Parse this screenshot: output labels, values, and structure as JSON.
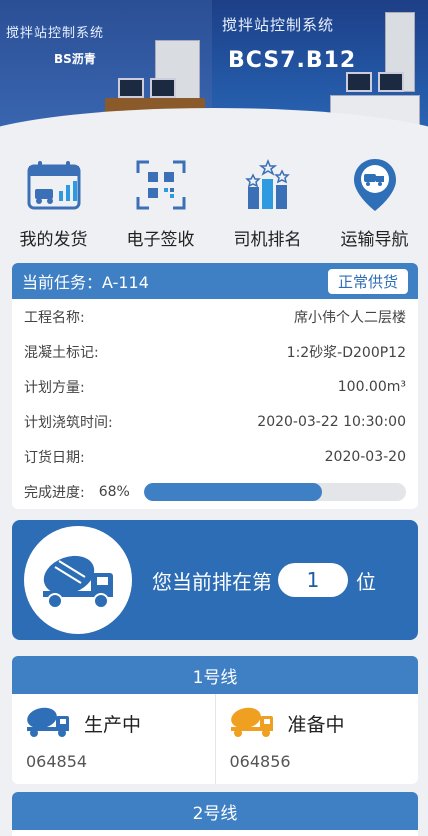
{
  "banner": {
    "left_title": "搅拌站控制系统",
    "left_subtitle": "BS沥青",
    "right_title": "搅拌站控制系统",
    "right_subtitle": "BCS7.B12"
  },
  "nav": [
    {
      "label": "我的发货",
      "icon": "delivery-calendar-icon"
    },
    {
      "label": "电子签收",
      "icon": "qr-code-icon"
    },
    {
      "label": "司机排名",
      "icon": "ranking-bars-icon"
    },
    {
      "label": "运输导航",
      "icon": "location-pin-icon"
    }
  ],
  "task": {
    "title": "当前任务：A-114",
    "status": "正常供货",
    "rows": [
      {
        "label": "工程名称:",
        "value": "席小伟个人二层楼"
      },
      {
        "label": "混凝土标记:",
        "value": "1:2砂浆-D200P12"
      },
      {
        "label": "计划方量:",
        "value": "100.00m³"
      },
      {
        "label": "计划浇筑时间:",
        "value": "2020-03-22 10:30:00"
      },
      {
        "label": "订货日期:",
        "value": "2020-03-20"
      }
    ],
    "progress_label": "完成进度:",
    "progress_text": "68%",
    "progress_value": 0.68
  },
  "queue": {
    "prefix": "您当前排在第",
    "position": "1",
    "suffix": "位"
  },
  "lines": [
    {
      "name": "1号线",
      "cells": [
        {
          "status": "生产中",
          "code": "064854",
          "color": "#2f6fb8"
        },
        {
          "status": "准备中",
          "code": "064856",
          "color": "#f0a020"
        }
      ]
    },
    {
      "name": "2号线"
    }
  ],
  "colors": {
    "primary": "#3f7fc4",
    "accent": "#f0a020"
  }
}
